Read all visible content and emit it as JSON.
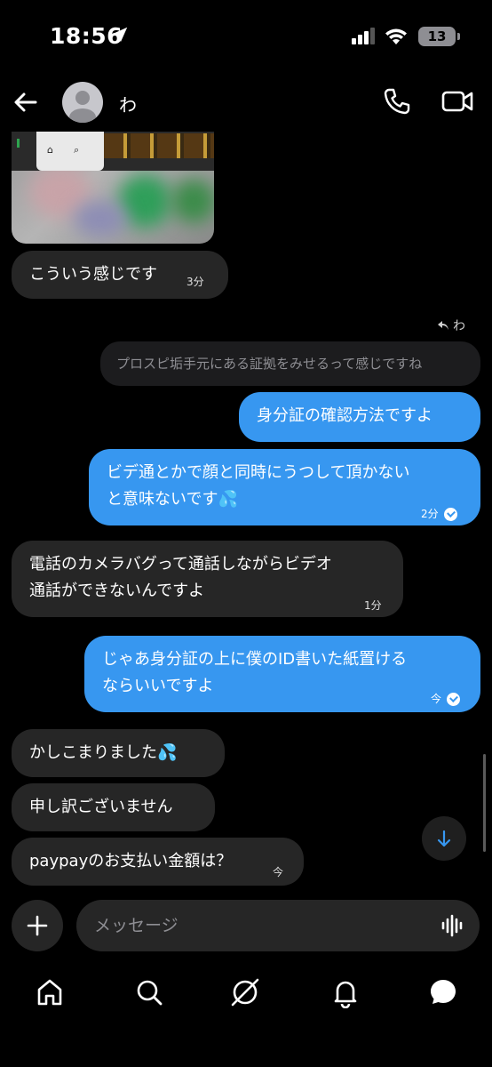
{
  "status_bar": {
    "time": "18:56",
    "battery": "13"
  },
  "header": {
    "contact_name": "わ"
  },
  "messages": [
    {
      "text": "こういう感じです",
      "time": "3分"
    },
    {
      "reply_label": "わ",
      "quoted": "プロスピ垢手元にある証拠をみせるって感じですね"
    },
    {
      "text": "身分証の確認方法ですよ"
    },
    {
      "text_line1": "ビデ通とかで顔と同時にうつして頂かない",
      "text_line2": "と意味ないです💦",
      "time": "2分"
    },
    {
      "text_line1": "電話のカメラバグって通話しながらビデオ",
      "text_line2": "通話ができないんですよ",
      "time": "1分"
    },
    {
      "text_line1": "じゃあ身分証の上に僕のID書いた紙置ける",
      "text_line2": "ならいいですよ",
      "time": "今"
    },
    {
      "text": "かしこまりました💦"
    },
    {
      "text": "申し訳ございません"
    },
    {
      "text": "paypayのお支払い金額は？",
      "time": "今"
    }
  ],
  "composer": {
    "placeholder": "メッセージ"
  },
  "image_preview": {
    "icon1": "⌂",
    "icon2": "⌕"
  },
  "icons": {
    "back": "arrow-left-icon",
    "call": "phone-icon",
    "video": "video-camera-icon",
    "plus": "plus-icon",
    "voice": "waveform-icon",
    "scroll": "arrow-down-icon",
    "tabs": [
      "home-icon",
      "search-icon",
      "explore-icon",
      "bell-icon",
      "message-icon"
    ]
  },
  "colors": {
    "sent_bubble": "#3797f0",
    "received_bubble": "#262626",
    "background": "#000000"
  }
}
